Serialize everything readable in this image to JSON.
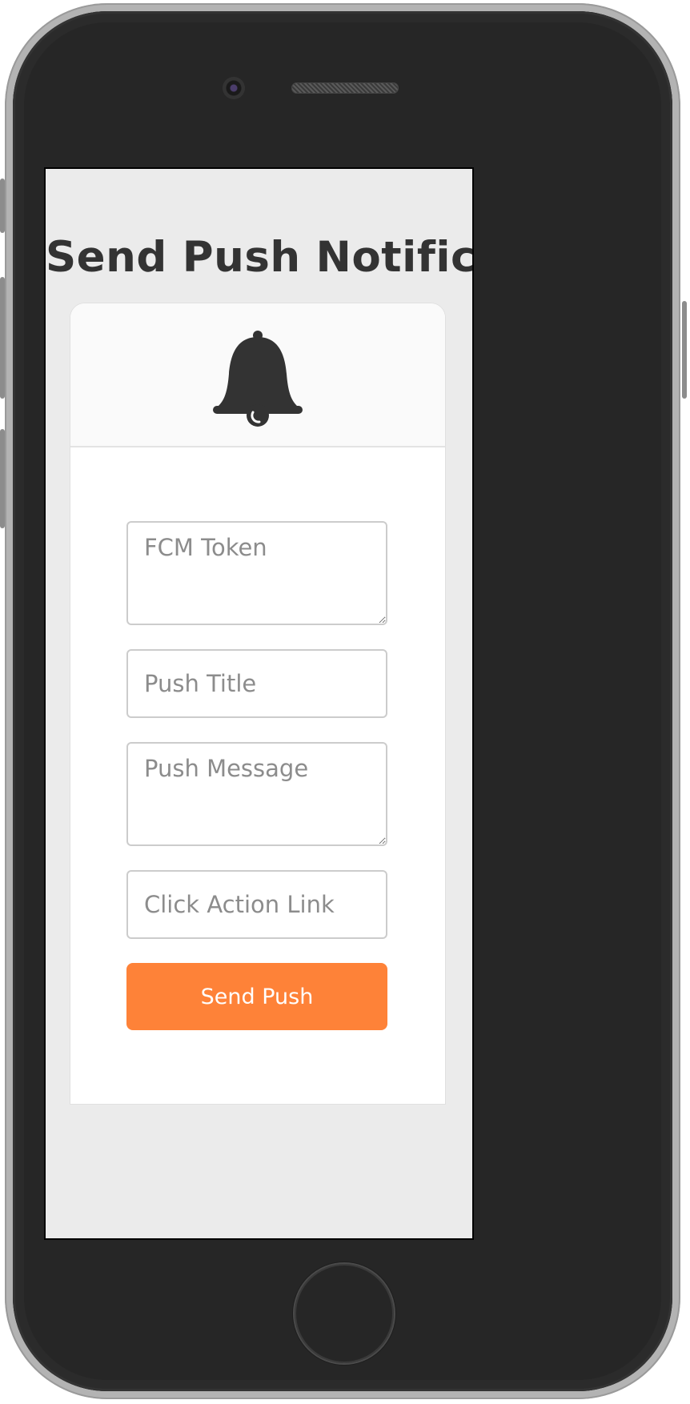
{
  "page": {
    "title": "Send Push Notification"
  },
  "header": {
    "icon": "bell-icon"
  },
  "form": {
    "fcm_token_placeholder": "FCM Token",
    "push_title_placeholder": "Push Title",
    "push_message_placeholder": "Push Message",
    "click_action_placeholder": "Click Action Link",
    "submit_label": "Send Push"
  },
  "colors": {
    "accent": "#fe8238",
    "title_text": "#333333",
    "screen_background": "#ebebeb",
    "placeholder_text": "#8c8c8c"
  }
}
